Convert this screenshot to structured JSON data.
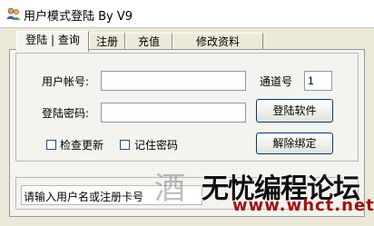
{
  "window": {
    "title": "用户模式登陆 By V9"
  },
  "tabs": [
    {
      "label": "登陆 | 查询"
    },
    {
      "label": "注册"
    },
    {
      "label": "充值"
    },
    {
      "label": "修改资料"
    }
  ],
  "form": {
    "account_label": "用户帐号:",
    "account_value": "",
    "password_label": "登陆密码:",
    "password_value": "",
    "channel_label": "通道号",
    "channel_value": "1",
    "login_button": "登陆软件",
    "unbind_button": "解除绑定",
    "check_update_label": "检查更新",
    "remember_password_label": "记住密码"
  },
  "status": {
    "text": "请输入用户名或注册卡号"
  },
  "watermark": {
    "glyph": "酒",
    "cn": "无忧编程论坛",
    "url": "www.whct.net"
  }
}
